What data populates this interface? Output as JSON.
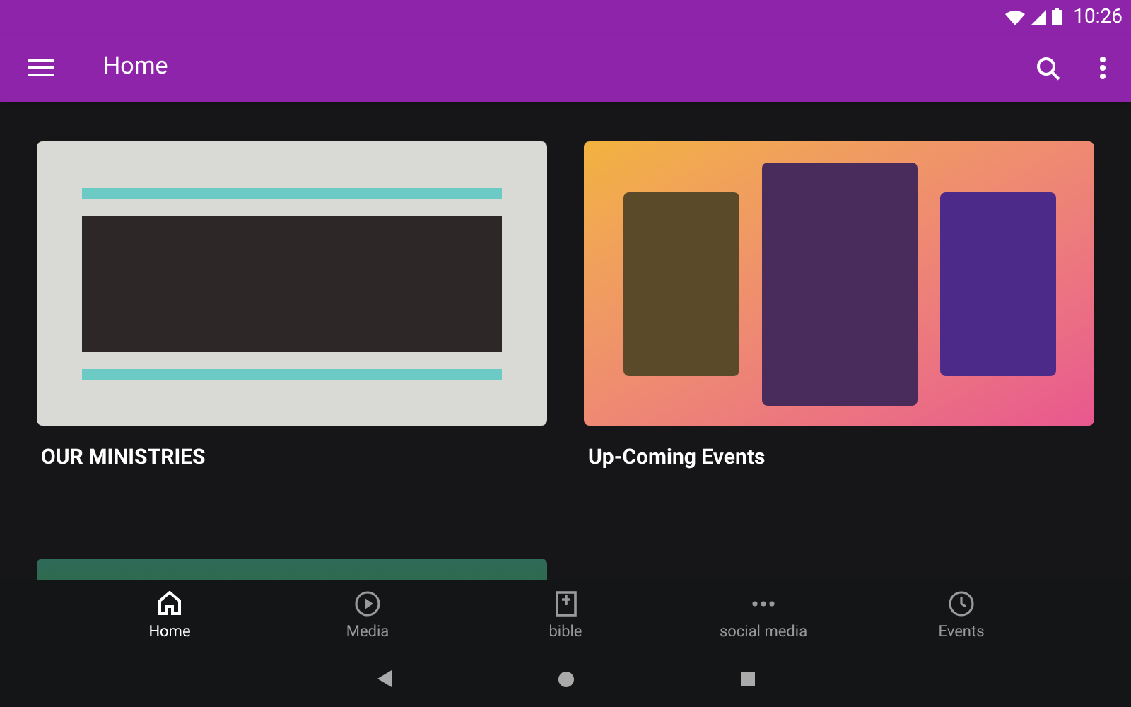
{
  "status_bar": {
    "time": "10:26"
  },
  "toolbar": {
    "title": "Home"
  },
  "cards": [
    {
      "title": "OUR MINISTRIES",
      "kind": "ministries"
    },
    {
      "title": "Up-Coming Events",
      "kind": "events"
    },
    {
      "kind": "forest"
    }
  ],
  "bottom_nav": [
    {
      "label": "Home",
      "selected": true
    },
    {
      "label": "Media",
      "selected": false
    },
    {
      "label": "bible",
      "selected": false
    },
    {
      "label": "social media",
      "selected": false
    },
    {
      "label": "Events",
      "selected": false
    }
  ]
}
